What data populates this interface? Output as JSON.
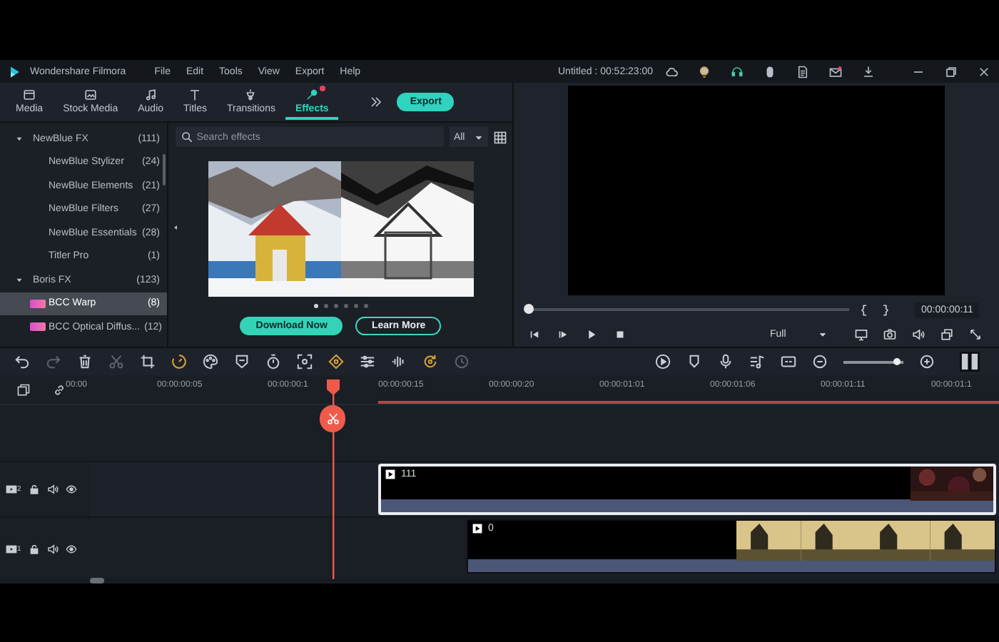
{
  "app": {
    "name": "Wondershare Filmora",
    "project_title": "Untitled : 00:52:23:00"
  },
  "menu": [
    "File",
    "Edit",
    "Tools",
    "View",
    "Export",
    "Help"
  ],
  "tabs": [
    {
      "label": "Media",
      "selected": false
    },
    {
      "label": "Stock Media",
      "selected": false
    },
    {
      "label": "Audio",
      "selected": false
    },
    {
      "label": "Titles",
      "selected": false
    },
    {
      "label": "Transitions",
      "selected": false
    },
    {
      "label": "Effects",
      "selected": true
    }
  ],
  "export_button": "Export",
  "effects": {
    "categories": [
      {
        "label": "NewBlue FX",
        "count": "(111)",
        "expanded": true,
        "children": [
          {
            "label": "NewBlue Stylizer",
            "count": "(24)",
            "selected": false,
            "badge": false
          },
          {
            "label": "NewBlue Elements",
            "count": "(21)",
            "selected": false,
            "badge": false
          },
          {
            "label": "NewBlue Filters",
            "count": "(27)",
            "selected": false,
            "badge": false
          },
          {
            "label": "NewBlue Essentials",
            "count": "(28)",
            "selected": false,
            "badge": false
          },
          {
            "label": "Titler Pro",
            "count": "(1)",
            "selected": false,
            "badge": false
          }
        ]
      },
      {
        "label": "Boris FX",
        "count": "(123)",
        "expanded": true,
        "children": [
          {
            "label": "BCC Warp",
            "count": "(8)",
            "selected": true,
            "badge": true
          },
          {
            "label": "BCC Optical Diffus...",
            "count": "(12)",
            "selected": false,
            "badge": true
          }
        ]
      }
    ],
    "search": {
      "placeholder": "Search effects"
    },
    "filter": {
      "value": "All"
    },
    "carousel": [
      {
        "selected": true
      },
      {
        "selected": false
      },
      {
        "selected": false
      },
      {
        "selected": false
      },
      {
        "selected": false
      },
      {
        "selected": false
      }
    ],
    "buttons": [
      {
        "label": "Download Now",
        "kind": "primary"
      },
      {
        "label": "Learn More",
        "kind": "outline"
      }
    ]
  },
  "preview": {
    "scrubber": {
      "level": 0
    },
    "time": "00:00:00:11",
    "quality": "Full"
  },
  "timeline": {
    "zoom": {
      "level": 0.9
    },
    "ruler": [
      "00:00",
      "00:00:00:05",
      "00:00:00:1",
      "00:00:00:15",
      "00:00:00:20",
      "00:00:01:01",
      "00:00:01:06",
      "00:00:01:11",
      "00:00:01:1"
    ],
    "tracks": [
      {
        "number": "2",
        "clip": {
          "title": "111",
          "selected": true
        }
      },
      {
        "number": "1",
        "clip": {
          "title": "0",
          "selected": false
        }
      }
    ]
  }
}
